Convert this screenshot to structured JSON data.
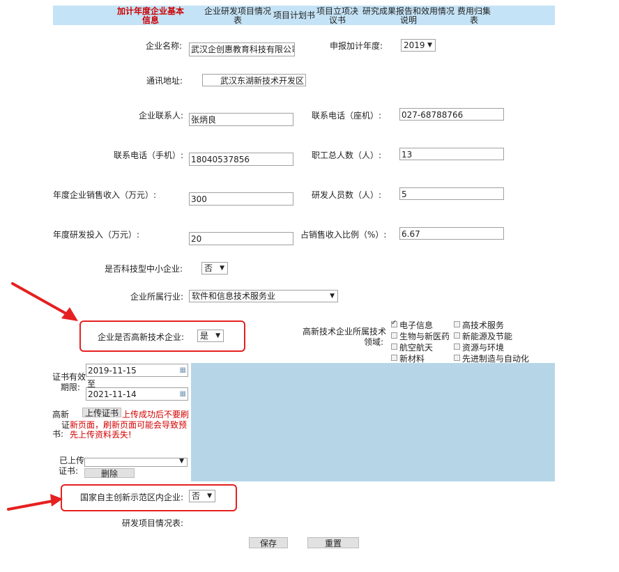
{
  "tabs": [
    {
      "label": "加计年度企业基本信息",
      "active": true
    },
    {
      "label": "企业研发项目情况表",
      "active": false
    },
    {
      "label": "项目计划书",
      "active": false
    },
    {
      "label": "项目立项决议书",
      "active": false
    },
    {
      "label": "研究成果报告和效用情况说明",
      "active": false
    },
    {
      "label": "费用归集表",
      "active": false
    }
  ],
  "form": {
    "company_name_label": "企业名称:",
    "company_name_value": "武汉企创惠教育科技有限公司",
    "year_label": "申报加计年度:",
    "year_value": "2019",
    "address_label": "通讯地址:",
    "address_value": "武汉东湖新技术开发区",
    "contact_label": "企业联系人:",
    "contact_value": "张炳良",
    "landline_label": "联系电话（座机）:",
    "landline_value": "027-68788766",
    "mobile_label": "联系电话（手机）:",
    "mobile_value": "18040537856",
    "employees_label": "职工总人数（人）:",
    "employees_value": "13",
    "sales_label": "年度企业销售收入（万元）:",
    "sales_value": "300",
    "rd_staff_label": "研发人员数（人）:",
    "rd_staff_value": "5",
    "rd_invest_label": "年度研发投入（万元）:",
    "rd_invest_value": "20",
    "ratio_label": "占销售收入比例（%）:",
    "ratio_value": "6.67",
    "tech_sme_label": "是否科技型中小企业:",
    "tech_sme_value": "否",
    "industry_label": "企业所属行业:",
    "industry_value": "软件和信息技术服务业",
    "hightech_label": "企业是否高新技术企业:",
    "hightech_value": "是",
    "field_label_1": "高新技术企业所属技术",
    "field_label_2": "领域:",
    "fields": [
      {
        "label": "电子信息",
        "checked": true
      },
      {
        "label": "高技术服务",
        "checked": false
      },
      {
        "label": "生物与新医药",
        "checked": false
      },
      {
        "label": "新能源及节能",
        "checked": false
      },
      {
        "label": "航空航天",
        "checked": false
      },
      {
        "label": "资源与环境",
        "checked": false
      },
      {
        "label": "新材料",
        "checked": false
      },
      {
        "label": "先进制造与自动化",
        "checked": false
      }
    ],
    "cert_period_label_1": "证书有效",
    "cert_period_label_2": "期限:",
    "cert_start": "2019-11-15",
    "cert_to": "至",
    "cert_end": "2021-11-14",
    "cert_upload_label_1": "高新",
    "cert_upload_label_2": "证",
    "cert_upload_label_3": "书:",
    "upload_button": "上传证书",
    "upload_warning_1": "上传成功后不要刷",
    "upload_warning_2": "新页面，刷新页面可能会导致预",
    "upload_warning_3": "先上传资料丢失!",
    "uploaded_label_1": "已上传",
    "uploaded_label_2": "证书:",
    "uploaded_value": "",
    "delete_button": "删除",
    "innovation_label": "国家自主创新示范区内企业:",
    "innovation_value": "否",
    "rd_projects_label": "研发项目情况表:",
    "save_button": "保存",
    "reset_button": "重置"
  },
  "colors": {
    "accent_red": "#e62020",
    "tab_bg": "#c5e3f6",
    "panel_blue": "#b6d6e8"
  }
}
